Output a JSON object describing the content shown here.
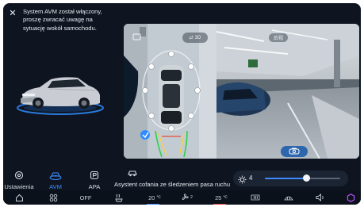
{
  "notice": {
    "line1": "System AVM został włączony,",
    "line2": "proszę zwracać uwagę na",
    "line3": "sytuację wokół samochodu."
  },
  "top_view": {
    "mode_label": "3D"
  },
  "rear_view": {
    "label": "后视"
  },
  "tabs": [
    {
      "label": "Ustawienia",
      "icon": "settings-icon",
      "active": false
    },
    {
      "label": "AVM",
      "icon": "car-camera-icon",
      "active": true
    },
    {
      "label": "APA",
      "icon": "parking-assist-icon",
      "active": false
    }
  ],
  "assist": {
    "label": "Asystent cofania ze śledzeniem pasa ruchu",
    "icon": "car-reverse-icon"
  },
  "brightness": {
    "value": "4",
    "level": 0.55
  },
  "bottom_bar": {
    "home_icon": "home-icon",
    "apps_icon": "apps-grid-icon",
    "fan_state": "OFF",
    "seat_heat_icon": "seat-heat-icon",
    "temp_left": "20",
    "temp_unit_left": "℃",
    "fan_level": "2",
    "temp_right": "25",
    "temp_unit_right": "℃",
    "defrost_rear_icon": "rear-defrost-icon",
    "defrost_front_icon": "front-defrost-icon",
    "volume_icon": "volume-icon",
    "brand_icon": "hexagon-logo-icon"
  },
  "colors": {
    "background": "#0e1520",
    "accent": "#3d8bff",
    "temp_left_line": "#3d8bff",
    "temp_right_line": "#e0463c",
    "brand": "#b04cf0"
  }
}
